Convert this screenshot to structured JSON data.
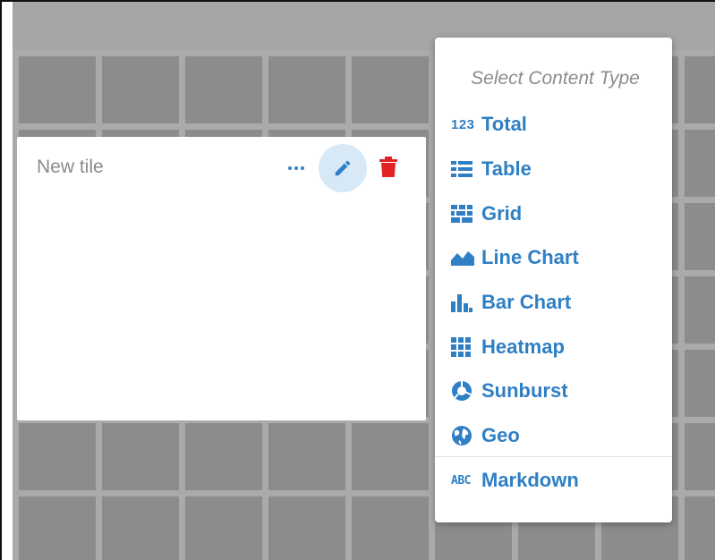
{
  "tile": {
    "title": "New tile"
  },
  "menu": {
    "header": "Select Content Type",
    "items": [
      {
        "label": "Total",
        "icon": "number-123-icon"
      },
      {
        "label": "Table",
        "icon": "table-icon"
      },
      {
        "label": "Grid",
        "icon": "grid-icon"
      },
      {
        "label": "Line Chart",
        "icon": "area-chart-icon"
      },
      {
        "label": "Bar Chart",
        "icon": "bar-chart-icon"
      },
      {
        "label": "Heatmap",
        "icon": "heatmap-icon"
      },
      {
        "label": "Sunburst",
        "icon": "sunburst-icon"
      },
      {
        "label": "Geo",
        "icon": "globe-icon"
      },
      {
        "label": "Markdown",
        "icon": "markdown-abc-icon"
      }
    ],
    "icon_texts": {
      "total": "123",
      "markdown": "ABC"
    }
  },
  "colors": {
    "accent": "#2f7fc5",
    "delete": "#e02424",
    "edit_highlight": "#d7e8f7"
  }
}
